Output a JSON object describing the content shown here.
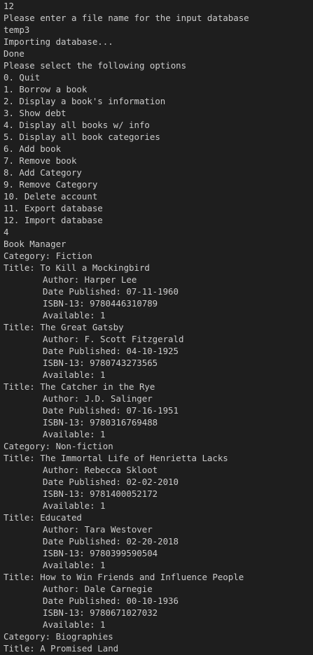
{
  "theme": {
    "background": "#1e1e1e",
    "foreground": "#cccccc"
  },
  "terminal": {
    "lines": [
      {
        "text": "12",
        "indent": false
      },
      {
        "text": "Please enter a file name for the input database",
        "indent": false
      },
      {
        "text": "temp3",
        "indent": false
      },
      {
        "text": "Importing database...",
        "indent": false
      },
      {
        "text": "Done",
        "indent": false
      },
      {
        "text": "Please select the following options",
        "indent": false
      },
      {
        "text": "0. Quit",
        "indent": false
      },
      {
        "text": "1. Borrow a book",
        "indent": false
      },
      {
        "text": "2. Display a book's information",
        "indent": false
      },
      {
        "text": "3. Show debt",
        "indent": false
      },
      {
        "text": "4. Display all books w/ info",
        "indent": false
      },
      {
        "text": "5. Display all book categories",
        "indent": false
      },
      {
        "text": "6. Add book",
        "indent": false
      },
      {
        "text": "7. Remove book",
        "indent": false
      },
      {
        "text": "8. Add Category",
        "indent": false
      },
      {
        "text": "9. Remove Category",
        "indent": false
      },
      {
        "text": "10. Delete account",
        "indent": false
      },
      {
        "text": "11. Export database",
        "indent": false
      },
      {
        "text": "12. Import database",
        "indent": false
      },
      {
        "text": "4",
        "indent": false
      },
      {
        "text": "Book Manager",
        "indent": false
      },
      {
        "text": "Category: Fiction",
        "indent": false
      },
      {
        "text": "Title: To Kill a Mockingbird",
        "indent": false
      },
      {
        "text": "Author: Harper Lee",
        "indent": true
      },
      {
        "text": "Date Published: 07-11-1960",
        "indent": true
      },
      {
        "text": "ISBN-13: 9780446310789",
        "indent": true
      },
      {
        "text": "Available: 1",
        "indent": true
      },
      {
        "text": "Title: The Great Gatsby",
        "indent": false
      },
      {
        "text": "Author: F. Scott Fitzgerald",
        "indent": true
      },
      {
        "text": "Date Published: 04-10-1925",
        "indent": true
      },
      {
        "text": "ISBN-13: 9780743273565",
        "indent": true
      },
      {
        "text": "Available: 1",
        "indent": true
      },
      {
        "text": "Title: The Catcher in the Rye",
        "indent": false
      },
      {
        "text": "Author: J.D. Salinger",
        "indent": true
      },
      {
        "text": "Date Published: 07-16-1951",
        "indent": true
      },
      {
        "text": "ISBN-13: 9780316769488",
        "indent": true
      },
      {
        "text": "Available: 1",
        "indent": true
      },
      {
        "text": "Category: Non-fiction",
        "indent": false
      },
      {
        "text": "Title: The Immortal Life of Henrietta Lacks",
        "indent": false
      },
      {
        "text": "Author: Rebecca Skloot",
        "indent": true
      },
      {
        "text": "Date Published: 02-02-2010",
        "indent": true
      },
      {
        "text": "ISBN-13: 9781400052172",
        "indent": true
      },
      {
        "text": "Available: 1",
        "indent": true
      },
      {
        "text": "Title: Educated",
        "indent": false
      },
      {
        "text": "Author: Tara Westover",
        "indent": true
      },
      {
        "text": "Date Published: 02-20-2018",
        "indent": true
      },
      {
        "text": "ISBN-13: 9780399590504",
        "indent": true
      },
      {
        "text": "Available: 1",
        "indent": true
      },
      {
        "text": "Title: How to Win Friends and Influence People",
        "indent": false
      },
      {
        "text": "Author: Dale Carnegie",
        "indent": true
      },
      {
        "text": "Date Published: 00-10-1936",
        "indent": true
      },
      {
        "text": "ISBN-13: 9780671027032",
        "indent": true
      },
      {
        "text": "Available: 1",
        "indent": true
      },
      {
        "text": "Category: Biographies",
        "indent": false
      },
      {
        "text": "Title: A Promised Land",
        "indent": false
      }
    ]
  }
}
